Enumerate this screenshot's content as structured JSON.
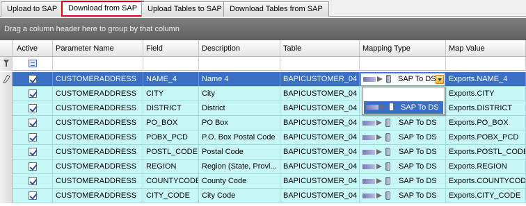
{
  "tabs": [
    {
      "label": "Upload to SAP"
    },
    {
      "label": "Download from SAP"
    },
    {
      "label": "Upload Tables to SAP"
    },
    {
      "label": "Download Tables from SAP"
    }
  ],
  "group_panel": {
    "text": "Drag a column header here to group by that column"
  },
  "columns": {
    "active": "Active",
    "parameter_name": "Parameter Name",
    "field": "Field",
    "description": "Description",
    "table": "Table",
    "mapping_type": "Mapping Type",
    "map_value": "Map Value"
  },
  "rows": [
    {
      "parameter_name": "CUSTOMERADDRESS",
      "field": "NAME_4",
      "description": "Name 4",
      "table": "BAPICUSTOMER_04",
      "mapping_type": "SAP To DS",
      "map_value": "Exports.NAME_4",
      "active": true
    },
    {
      "parameter_name": "CUSTOMERADDRESS",
      "field": "CITY",
      "description": "City",
      "table": "BAPICUSTOMER_04",
      "mapping_type": "SAP To DS",
      "map_value": "Exports.CITY",
      "active": true
    },
    {
      "parameter_name": "CUSTOMERADDRESS",
      "field": "DISTRICT",
      "description": "District",
      "table": "BAPICUSTOMER_04",
      "mapping_type": "SAP To DS",
      "map_value": "Exports.DISTRICT",
      "active": true
    },
    {
      "parameter_name": "CUSTOMERADDRESS",
      "field": "PO_BOX",
      "description": "PO Box",
      "table": "BAPICUSTOMER_04",
      "mapping_type": "SAP To DS",
      "map_value": "Exports.PO_BOX",
      "active": true
    },
    {
      "parameter_name": "CUSTOMERADDRESS",
      "field": "POBX_PCD",
      "description": "P.O. Box Postal Code",
      "table": "BAPICUSTOMER_04",
      "mapping_type": "SAP To DS",
      "map_value": "Exports.POBX_PCD",
      "active": true
    },
    {
      "parameter_name": "CUSTOMERADDRESS",
      "field": "POSTL_CODE",
      "description": "Postal Code",
      "table": "BAPICUSTOMER_04",
      "mapping_type": "SAP To DS",
      "map_value": "Exports.POSTL_CODE",
      "active": true
    },
    {
      "parameter_name": "CUSTOMERADDRESS",
      "field": "REGION",
      "description": "Region (State, Provi...",
      "table": "BAPICUSTOMER_04",
      "mapping_type": "SAP To DS",
      "map_value": "Exports.REGION",
      "active": true
    },
    {
      "parameter_name": "CUSTOMERADDRESS",
      "field": "COUNTYCODE",
      "description": "County Code",
      "table": "BAPICUSTOMER_04",
      "mapping_type": "SAP To DS",
      "map_value": "Exports.COUNTYCODE",
      "active": true
    },
    {
      "parameter_name": "CUSTOMERADDRESS",
      "field": "CITY_CODE",
      "description": "City Code",
      "table": "BAPICUSTOMER_04",
      "mapping_type": "SAP To DS",
      "map_value": "Exports.CITY_CODE",
      "active": true
    }
  ],
  "dropdown": {
    "options": [
      "SAP To DS"
    ]
  },
  "colors": {
    "selected_row": "#3a6fc6",
    "row_bg": "#c8f7f7",
    "active_tab_border": "#e3000f"
  }
}
